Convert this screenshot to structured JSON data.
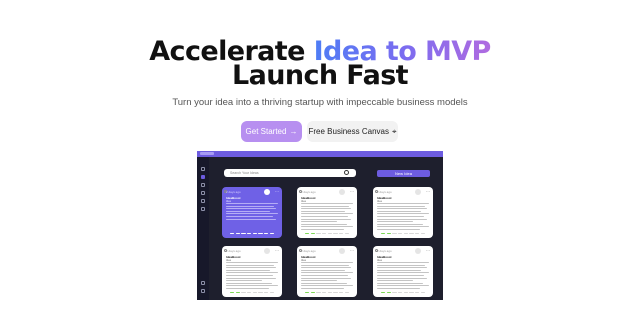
{
  "hero": {
    "line1_start": "Accelerate ",
    "line1_highlight": "Idea to MVP",
    "line2": "Launch Fast",
    "subtitle": "Turn your idea into a thriving startup with impeccable business models"
  },
  "buttons": {
    "primary_label": "Get Started",
    "primary_icon": "→",
    "secondary_label": "Free Business Canvas",
    "secondary_icon": "⌖"
  },
  "preview": {
    "search_placeholder": "Search Your Ideas",
    "new_idea_label": "New Idea",
    "cards": [
      {
        "header": "2 days ago",
        "title": "IdeaBoost",
        "label": "Idea",
        "variant": "purple"
      },
      {
        "header": "2 days ago",
        "title": "IdeaBoost",
        "label": "Idea",
        "variant": "white"
      },
      {
        "header": "2 days ago",
        "title": "IdeaBoost",
        "label": "Idea",
        "variant": "white"
      },
      {
        "header": "2 days ago",
        "title": "IdeaBoost",
        "label": "Idea",
        "variant": "white"
      },
      {
        "header": "2 days ago",
        "title": "IdeaBoost",
        "label": "Idea",
        "variant": "white"
      },
      {
        "header": "2 days ago",
        "title": "IdeaBoost",
        "label": "Idea",
        "variant": "white"
      }
    ]
  },
  "colors": {
    "accent": "#b78ff0",
    "brand_purple": "#6d5ce0",
    "app_bg": "#1e1f2d",
    "progress_green": "#7ed957"
  }
}
